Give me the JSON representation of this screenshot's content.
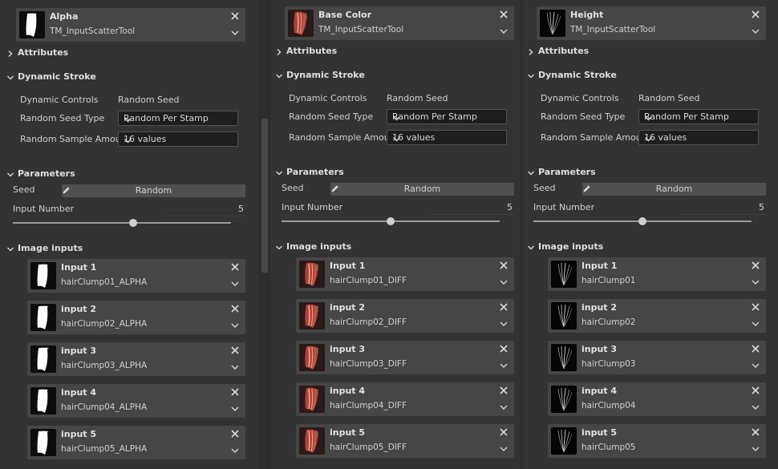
{
  "panels": [
    {
      "kind": "alpha",
      "title": "Alpha",
      "subtitle": "TM_InputScatterTool",
      "attributes": "Attributes",
      "dynamic_stroke": "Dynamic Stroke",
      "dynamic_controls_label": "Dynamic Controls",
      "dynamic_controls_value": "Random Seed",
      "random_seed_type_label": "Random Seed Type",
      "random_seed_type_value": "Random Per Stamp",
      "random_sample_amount_label": "Random Sample Amount",
      "random_sample_amount_value": "16 values",
      "parameters": "Parameters",
      "seed_label": "Seed",
      "seed_value": "Random",
      "input_number_label": "Input Number",
      "input_number_value": "5",
      "slider_fraction": 0.55,
      "image_inputs": "Image inputs",
      "inputs": [
        {
          "name": "Input 1",
          "value": "hairClump01_ALPHA"
        },
        {
          "name": "input 2",
          "value": "hairClump02_ALPHA"
        },
        {
          "name": "input 3",
          "value": "hairClump03_ALPHA"
        },
        {
          "name": "input 4",
          "value": "hairClump04_ALPHA"
        },
        {
          "name": "input 5",
          "value": "hairClump05_ALPHA"
        }
      ]
    },
    {
      "kind": "color",
      "title": "Base Color",
      "subtitle": "TM_InputScatterTool",
      "attributes": "Attributes",
      "dynamic_stroke": "Dynamic Stroke",
      "dynamic_controls_label": "Dynamic Controls",
      "dynamic_controls_value": "Random Seed",
      "random_seed_type_label": "Random Seed Type",
      "random_seed_type_value": "Random Per Stamp",
      "random_sample_amount_label": "Random Sample Amount",
      "random_sample_amount_value": "16 values",
      "parameters": "Parameters",
      "seed_label": "Seed",
      "seed_value": "Random",
      "input_number_label": "Input Number",
      "input_number_value": "5",
      "slider_fraction": 0.5,
      "image_inputs": "Image inputs",
      "inputs": [
        {
          "name": "Input 1",
          "value": "hairClump01_DIFF"
        },
        {
          "name": "input 2",
          "value": "hairClump02_DIFF"
        },
        {
          "name": "input 3",
          "value": "hairClump03_DIFF"
        },
        {
          "name": "input 4",
          "value": "hairClump04_DIFF"
        },
        {
          "name": "input 5",
          "value": "hairClump05_DIFF"
        }
      ]
    },
    {
      "kind": "height",
      "title": "Height",
      "subtitle": "TM_InputScatterTool",
      "attributes": "Attributes",
      "dynamic_stroke": "Dynamic Stroke",
      "dynamic_controls_label": "Dynamic Controls",
      "dynamic_controls_value": "Random Seed",
      "random_seed_type_label": "Random Seed Type",
      "random_seed_type_value": "Random Per Stamp",
      "random_sample_amount_label": "Random Sample Amount",
      "random_sample_amount_value": "16 values",
      "parameters": "Parameters",
      "seed_label": "Seed",
      "seed_value": "Random",
      "input_number_label": "Input Number",
      "input_number_value": "5",
      "slider_fraction": 0.5,
      "image_inputs": "Image inputs",
      "inputs": [
        {
          "name": "Input 1",
          "value": "hairClump01"
        },
        {
          "name": "input 2",
          "value": "hairClump02"
        },
        {
          "name": "input 3",
          "value": "hairClump03"
        },
        {
          "name": "input 4",
          "value": "hairClump04"
        },
        {
          "name": "input 5",
          "value": "hairClump05"
        }
      ]
    }
  ],
  "icons": {
    "close": "close-icon",
    "chevron": "chevron-down-icon",
    "expand": "expand-arrow-icon",
    "edit": "pencil-icon"
  },
  "colors": {
    "panel_bg": "#333333",
    "header_bg": "#464646",
    "field_bg": "#1e1e1e",
    "text": "#d6d6d6"
  }
}
